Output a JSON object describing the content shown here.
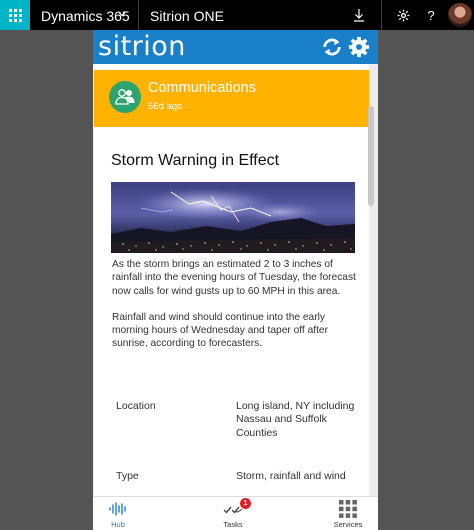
{
  "topbar": {
    "product": "Dynamics 365",
    "app": "Sitrion ONE",
    "icons": [
      "app-launcher-icon",
      "chevron-down-icon",
      "download-icon",
      "settings-gear-icon",
      "help-icon",
      "user-avatar"
    ]
  },
  "header": {
    "logo": "sitrion",
    "color": "#1a7fc9",
    "icons": [
      "refresh-icon",
      "gear-icon"
    ]
  },
  "banner": {
    "title": "Communications",
    "time": "56d ago",
    "color": "#ffb300",
    "icon": "people-icon"
  },
  "post": {
    "title": "Storm Warning in Effect",
    "paragraphs": [
      "As the storm brings an estimated 2 to 3 inches of rainfall into the evening hours of Tuesday, the forecast now calls for wind gusts up to 60 MPH in this area.",
      "Rainfall and wind should continue into the early morning hours of Wednesday and taper off after sunrise, according to forecasters."
    ],
    "fields": [
      {
        "label": "Location",
        "value": "Long island, NY including Nassau and Suffolk Counties"
      },
      {
        "label": "Type",
        "value": "Storm, rainfall and wind"
      }
    ]
  },
  "bottom_nav": {
    "items": [
      {
        "label": "Hub",
        "icon": "hub-waveform-icon",
        "active": true
      },
      {
        "label": "Tasks",
        "icon": "tasks-icon",
        "badge": "1"
      },
      {
        "label": "Services",
        "icon": "grid-icon"
      }
    ]
  }
}
